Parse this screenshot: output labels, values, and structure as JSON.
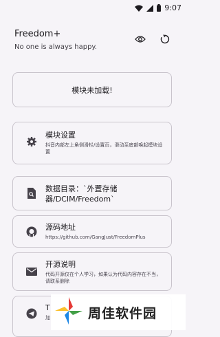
{
  "status_bar": {
    "time": "9:07",
    "icons": [
      "wifi-icon",
      "signal-icon",
      "battery-icon"
    ]
  },
  "app_bar": {
    "title": "Freedom+",
    "subtitle": "No one is always happy.",
    "actions": [
      "eye-icon",
      "refresh-icon"
    ]
  },
  "module_status": {
    "label": "模块未加载!"
  },
  "items": [
    {
      "icon": "gear-icon",
      "title": "模块设置",
      "desc": "抖音内部左上角侧滑栏/设置页，滑动至底部唤起模块设置"
    },
    {
      "icon": "folder-search-icon",
      "title": "数据目录：`外置存储器/DCIM/Freedom`"
    },
    {
      "icon": "github-icon",
      "title": "源码地址",
      "desc": "https://github.com/GangJust/FreedomPlus"
    },
    {
      "icon": "mail-icon",
      "title": "开源说明",
      "desc": "代码开源仅在个人学习，如果认为代码内容存在不当，请联系删除"
    },
    {
      "icon": "telegram-icon",
      "title": "T",
      "desc": "加"
    }
  ],
  "watermark": {
    "text": "周佳软件园"
  },
  "colors": {
    "background": "#f6f4f8",
    "border": "#c9c4cc",
    "text": "#1d1b1f"
  }
}
